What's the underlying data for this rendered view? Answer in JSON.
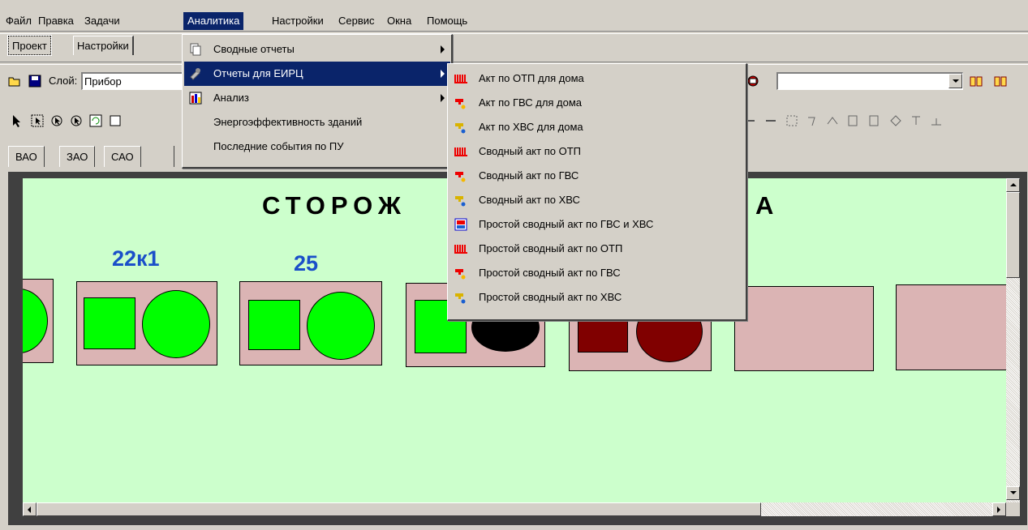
{
  "menubar": {
    "items": [
      "Файл",
      "Правка",
      "Задачи",
      "Аналитика",
      "Настройки",
      "Сервис",
      "Окна",
      "Помощь"
    ],
    "active": "Аналитика"
  },
  "project_tabs": [
    "Проект",
    "Настройки"
  ],
  "toolbar": {
    "layer_label": "Слой:",
    "layer_value": "Прибор",
    "right_combo_value": ""
  },
  "district_tabs": [
    "ВАО",
    "ЗАО",
    "САО"
  ],
  "schema": {
    "title": "СТОРОЖ",
    "title_tail": "А",
    "buildings": [
      {
        "number": "",
        "square_color": "#00ff00",
        "circle_color": "#00ff00"
      },
      {
        "number": "22к1",
        "square_color": "#00ff00",
        "circle_color": "#00ff00"
      },
      {
        "number": "25",
        "square_color": "#00ff00",
        "circle_color": "#00ff00"
      },
      {
        "number": "",
        "square_color": "#00ff00",
        "circle_color": "#000000"
      },
      {
        "number": "",
        "square_color": "#800000",
        "circle_color": "#800000"
      },
      {
        "number": "",
        "square_color": "",
        "circle_color": ""
      },
      {
        "number": "",
        "square_color": "",
        "circle_color": ""
      }
    ]
  },
  "analytics_menu": {
    "items": [
      {
        "label": "Сводные отчеты",
        "submenu": true,
        "icon": "pages-icon"
      },
      {
        "label": "Отчеты для ЕИРЦ",
        "submenu": true,
        "icon": "tools-icon",
        "highlighted": true
      },
      {
        "label": "Анализ",
        "submenu": true,
        "icon": "bar-chart-icon"
      },
      {
        "label": "Энергоэффективность зданий",
        "submenu": false,
        "icon": ""
      },
      {
        "label": "Последние события по ПУ",
        "submenu": false,
        "icon": ""
      }
    ]
  },
  "eirc_submenu": {
    "items": [
      {
        "label": "Акт по ОТП для дома",
        "icon": "radiator-icon"
      },
      {
        "label": "Акт по ГВС для дома",
        "icon": "hot-water-tap-icon"
      },
      {
        "label": "Акт по ХВС для дома",
        "icon": "cold-water-tap-icon"
      },
      {
        "label": "Сводный акт по ОТП",
        "icon": "radiator-icon"
      },
      {
        "label": "Сводный акт по ГВС",
        "icon": "hot-water-tap-icon"
      },
      {
        "label": "Сводный акт по ХВС",
        "icon": "cold-water-tap-icon"
      },
      {
        "label": "Простой сводный акт по ГВС и ХВС",
        "icon": "report-icon"
      },
      {
        "label": "Простой сводный акт по ОТП",
        "icon": "radiator-icon"
      },
      {
        "label": "Простой сводный акт по ГВС",
        "icon": "hot-water-tap-icon"
      },
      {
        "label": "Простой сводный акт по ХВС",
        "icon": "cold-water-tap-icon"
      }
    ]
  },
  "colors": {
    "schema_bg": "#ccffcc",
    "building_fill": "#dbb4b4",
    "menu_highlight": "#0a246a",
    "number_color": "#1a4fc9"
  }
}
